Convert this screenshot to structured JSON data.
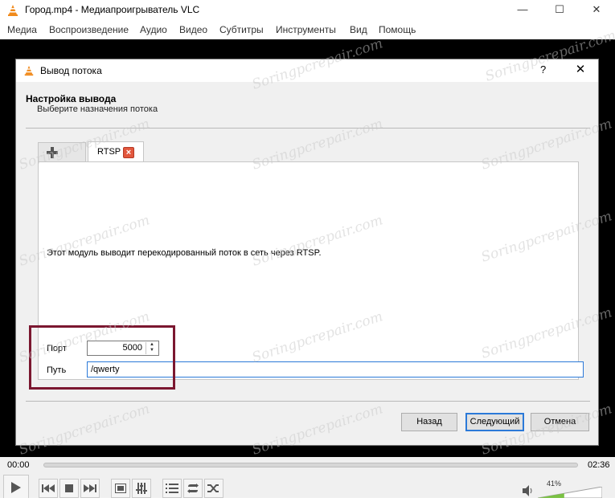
{
  "window": {
    "title": "Город.mp4 - Медиапроигрыватель VLC",
    "minimize": "—",
    "maximize": "☐",
    "close": "✕"
  },
  "menu": [
    "Медиа",
    "Воспроизведение",
    "Аудио",
    "Видео",
    "Субтитры",
    "Инструменты",
    "Вид",
    "Помощь"
  ],
  "dialog": {
    "title": "Вывод потока",
    "help": "?",
    "close": "✕",
    "header_title": "Настройка вывода",
    "header_subtitle": "Выберите назначения потока",
    "tab_rtsp": "RTSP",
    "tab_close": "×",
    "description": "Этот модуль выводит перекодированный поток в сеть через RTSP.",
    "port_label": "Порт",
    "port_value": "5000",
    "path_label": "Путь",
    "path_value": "/qwerty",
    "btn_back": "Назад",
    "btn_next": "Следующий",
    "btn_cancel": "Отмена"
  },
  "controls": {
    "time_elapsed": "00:00",
    "time_total": "02:36",
    "volume_percent": "41%",
    "volume_level": 0.41
  },
  "watermark": "Soringpcrepair.com",
  "colors": {
    "accent": "#2b79d8",
    "highlight": "#7b1730",
    "vlc_orange": "#f08a1c",
    "volume_green": "#7ac143"
  }
}
